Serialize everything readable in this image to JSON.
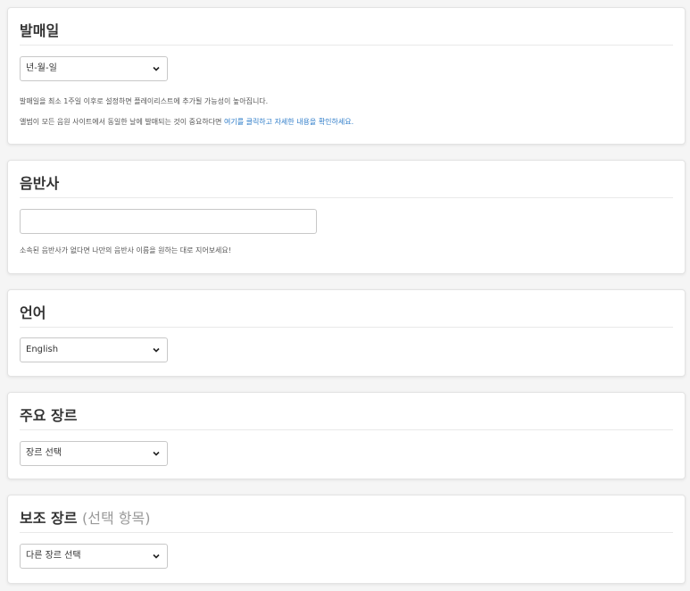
{
  "release_date": {
    "title": "발매일",
    "select_value": "년-월-일",
    "help_line1": "발매일을 최소 1주일 이후로 설정하면 플레이리스트에 추가될 가능성이 높아집니다.",
    "help_line2_prefix": "앨범이 모든 음원 사이트에서 동일한 날에 발매되는 것이 중요하다면 ",
    "help_line2_link": "여기를 클릭하고 자세한 내용을 확인하세요."
  },
  "label": {
    "title": "음반사",
    "input_value": "",
    "help": "소속된 음반사가 없다면 나만의 음반사 이름을 원하는 대로 지어보세요!"
  },
  "language": {
    "title": "언어",
    "select_value": "English"
  },
  "primary_genre": {
    "title": "주요 장르",
    "select_value": "장르 선택"
  },
  "secondary_genre": {
    "title": "보조 장르",
    "optional": "(선택 항목)",
    "select_value": "다른 장르 선택"
  },
  "colors": {
    "background": "#f5f5f5",
    "card": "#ffffff",
    "link": "#2e7cc9",
    "muted": "#999999"
  }
}
